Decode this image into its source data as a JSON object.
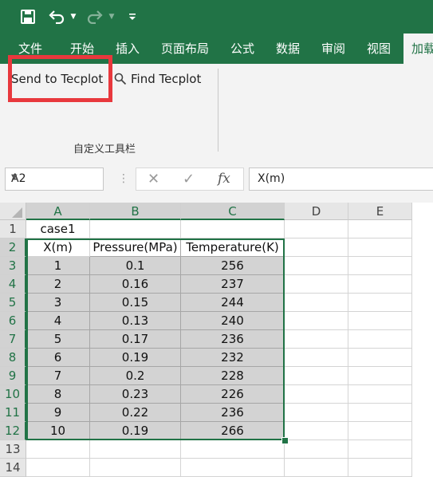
{
  "quick_access": {
    "save_icon": "save-icon",
    "undo_icon": "undo-icon",
    "redo_icon": "redo-icon",
    "customize_icon": "customize-qat-icon"
  },
  "tabs": [
    "文件",
    "开始",
    "插入",
    "页面布局",
    "公式",
    "数据",
    "审阅",
    "视图",
    "加载"
  ],
  "ribbon": {
    "send_label": "Send to Tecplot",
    "find_label": "Find Tecplot",
    "group_label": "自定义工具栏",
    "highlight_color": "#e8383d"
  },
  "formula_bar": {
    "name_box": "A2",
    "formula": "X(m)"
  },
  "sheet": {
    "columns": [
      "A",
      "B",
      "C",
      "D",
      "E"
    ],
    "rows": [
      "1",
      "2",
      "3",
      "4",
      "5",
      "6",
      "7",
      "8",
      "9",
      "10",
      "11",
      "12",
      "13",
      "14"
    ],
    "cells": [
      [
        "case1",
        "",
        ""
      ],
      [
        "X(m)",
        "Pressure(MPa)",
        "Temperature(K)"
      ],
      [
        "1",
        "0.1",
        "256"
      ],
      [
        "2",
        "0.16",
        "237"
      ],
      [
        "3",
        "0.15",
        "244"
      ],
      [
        "4",
        "0.13",
        "240"
      ],
      [
        "5",
        "0.17",
        "236"
      ],
      [
        "6",
        "0.19",
        "232"
      ],
      [
        "7",
        "0.2",
        "228"
      ],
      [
        "8",
        "0.23",
        "226"
      ],
      [
        "9",
        "0.22",
        "236"
      ],
      [
        "10",
        "0.19",
        "266"
      ]
    ],
    "accent_color": "#217346"
  }
}
